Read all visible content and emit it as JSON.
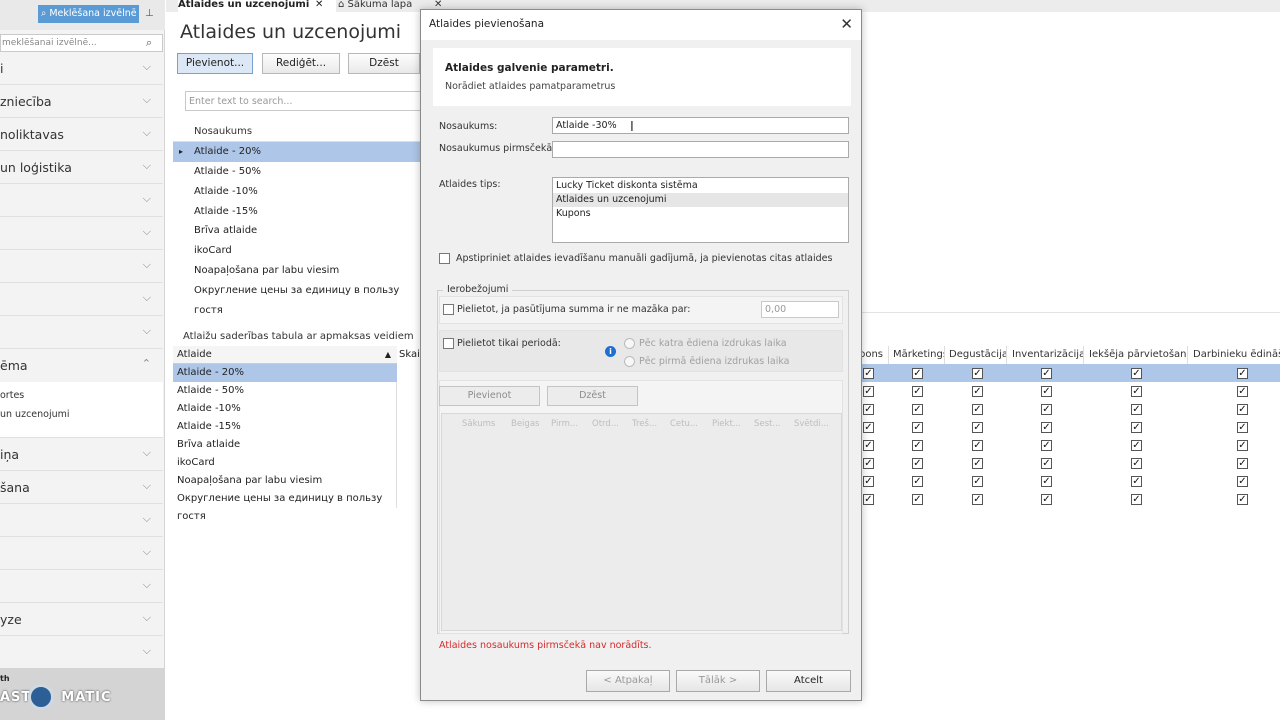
{
  "sidebar": {
    "title": "Meklēšana izvēlnē",
    "search_placeholder": "meklēšanai izvēlnē...",
    "items": [
      {
        "label": "i"
      },
      {
        "label": "zniecība"
      },
      {
        "label": "noliktavas"
      },
      {
        "label": "un loģistika"
      },
      {
        "label": ""
      },
      {
        "label": ""
      },
      {
        "label": ""
      },
      {
        "label": ""
      },
      {
        "label": ""
      },
      {
        "label": "ēma"
      },
      {
        "label": "iņa"
      },
      {
        "label": "šana"
      },
      {
        "label": ""
      },
      {
        "label": ""
      },
      {
        "label": ""
      },
      {
        "label": "yze"
      },
      {
        "label": ""
      }
    ],
    "subitems": [
      "ortes",
      "un uzcenojumi"
    ],
    "watermark_small": "th",
    "watermark_left": "AST",
    "watermark_right": "MATIC"
  },
  "tabs": [
    {
      "label": "Atlaides un uzcenojumi"
    },
    {
      "label": "Sākuma lapa"
    }
  ],
  "main": {
    "title": "Atlaides un uzcenojumi",
    "toolbar": {
      "add": "Pievienot...",
      "edit": "Rediģēt...",
      "delete": "Dzēst"
    },
    "search_placeholder": "Enter text to search...",
    "list_header": "Nosaukums",
    "list": [
      "Atlaide - 20%",
      "Atlaide - 50%",
      "Atlaide -10%",
      "Atlaide -15%",
      "Brīva atlaide",
      "ikoCard",
      "Noapaļošana par labu viesim",
      "Округление цены за единицу в пользу гостя"
    ],
    "selected_index": 0
  },
  "compat": {
    "title": "Atlaižu saderības tabula ar apmaksas veidiem",
    "header": "Atlaide",
    "extra_col": "Skai",
    "rows": [
      "Atlaide - 20%",
      "Atlaide - 50%",
      "Atlaide -10%",
      "Atlaide -15%",
      "Brīva atlaide",
      "ikoCard",
      "Noapaļošana par labu viesim",
      "Округление цены за единицу в пользу гостя"
    ],
    "columns": [
      "pons",
      "Mārketings",
      "Degustācija",
      "Inventarizācija",
      "Iekšēja pārvietošana",
      "Darbinieku ēdināš"
    ],
    "check_mark": "✓"
  },
  "dialog": {
    "title": "Atlaides pievienošana",
    "header_title": "Atlaides galvenie parametri.",
    "header_sub": "Norādiet atlaides pamatparametrus",
    "name_label": "Nosaukums:",
    "name_value": "Atlaide -30%",
    "precheck_label": "Nosaukumus pirmsčekā:",
    "precheck_value": "",
    "type_label": "Atlaides tips:",
    "types": [
      "Lucky Ticket diskonta sistēma",
      "Atlaides un uzcenojumi",
      "Kupons"
    ],
    "type_selected": 1,
    "confirm_label": "Apstipriniet atlaides ievadīšanu manuāli gadījumā, ja pievienotas citas atlaides",
    "group_label": "Ierobežojumi",
    "min_sum_label": "Pielietot, ja pasūtījuma summa ir ne mazāka par:",
    "min_sum_value": "0,00",
    "period_label": "Pielietot tikai periodā:",
    "radio1": "Pēc katra ēdiena izdrukas laika",
    "radio2": "Pēc pirmā ēdiena izdrukas laika",
    "grid_add": "Pievienot",
    "grid_delete": "Dzēst",
    "grid_headers": [
      "Sākums",
      "Beigas",
      "Pirm...",
      "Otrd...",
      "Treš...",
      "Cetu...",
      "Piekt...",
      "Sest...",
      "Svētdi..."
    ],
    "error": "Atlaides nosaukums pirmsčekā nav norādīts.",
    "back": "< Atpakaļ",
    "next": "Tālāk >",
    "cancel": "Atcelt"
  },
  "colors": {
    "accent": "#5b9bd5",
    "selection": "#aec6e8",
    "error": "#d52b2b"
  }
}
